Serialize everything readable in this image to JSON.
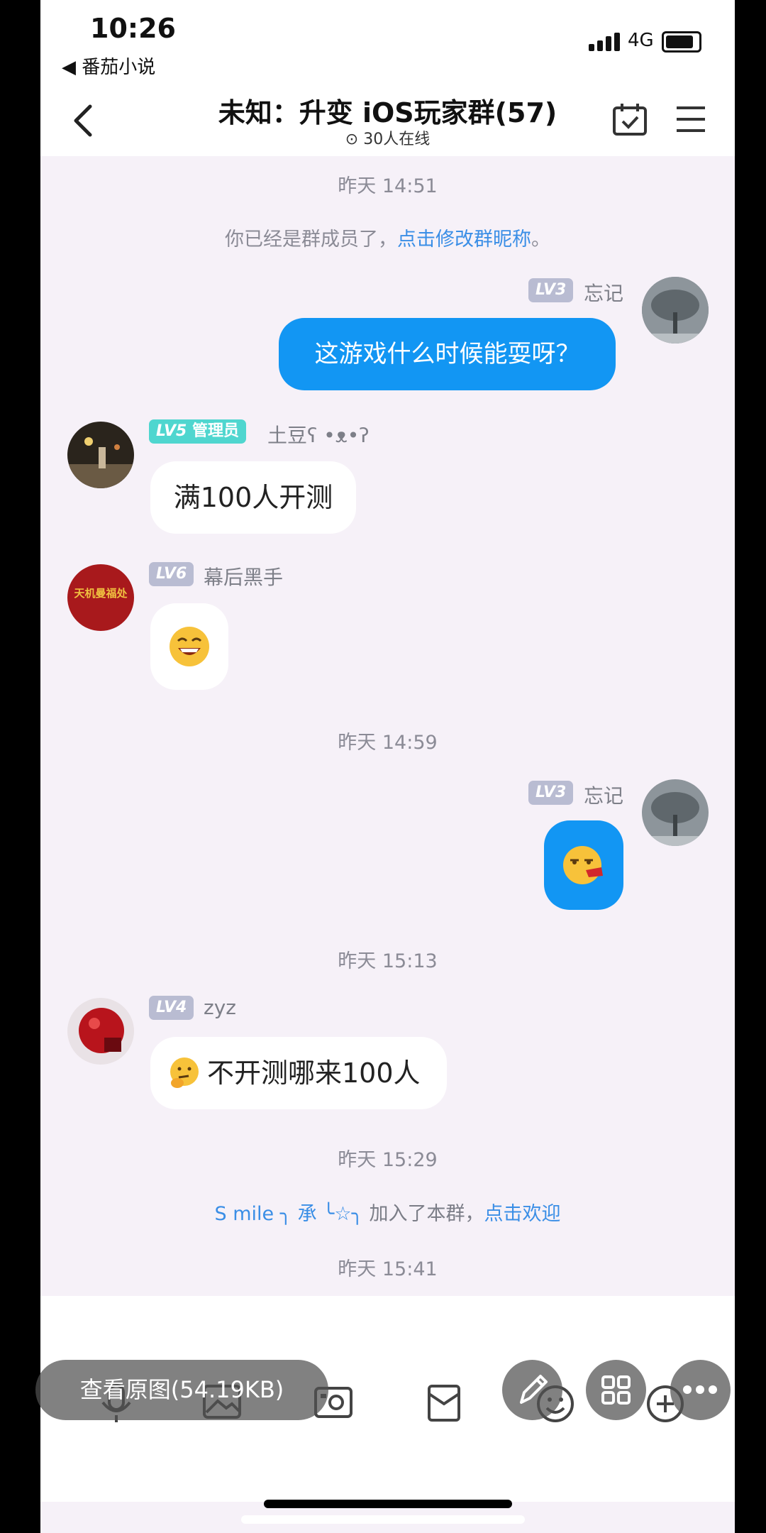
{
  "status_bar": {
    "time": "10:26",
    "back_app": "◀ 番茄小说",
    "network": "4G"
  },
  "header": {
    "title": "未知：升变 iOS玩家群(57)",
    "online": "30人在线"
  },
  "chat": {
    "ts1": "昨天 14:51",
    "sys1_prefix": "你已经是群成员了，",
    "sys1_link": "点击修改群昵称",
    "sys1_suffix": "。",
    "m1": {
      "level": "LV3",
      "name": "忘记",
      "text": "这游戏什么时候能耍呀？"
    },
    "m2": {
      "level": "LV5",
      "role": "管理员",
      "name": "土豆ʕ •ᴥ•ʔ",
      "text": "满100人开测"
    },
    "m3": {
      "level": "LV6",
      "name": "幕后黑手",
      "avatar_text": "天机曼福处"
    },
    "ts2": "昨天 14:59",
    "m4": {
      "level": "LV3",
      "name": "忘记"
    },
    "ts3": "昨天 15:13",
    "m5": {
      "level": "LV4",
      "name": "zyz",
      "text": "不开测哪来100人"
    },
    "ts4": "昨天 15:29",
    "sys2_name": "S mile ╮ 承 ╰☆╮",
    "sys2_middle": " 加入了本群，",
    "sys2_link": "点击欢迎",
    "ts5": "昨天 15:41"
  },
  "overlay": {
    "view_original": "查看原图(54.19KB)"
  },
  "colors": {
    "accent": "#1296f3",
    "link": "#3a8ee6",
    "background": "#f6f1f8",
    "admin_badge": "#4fd6cf"
  }
}
